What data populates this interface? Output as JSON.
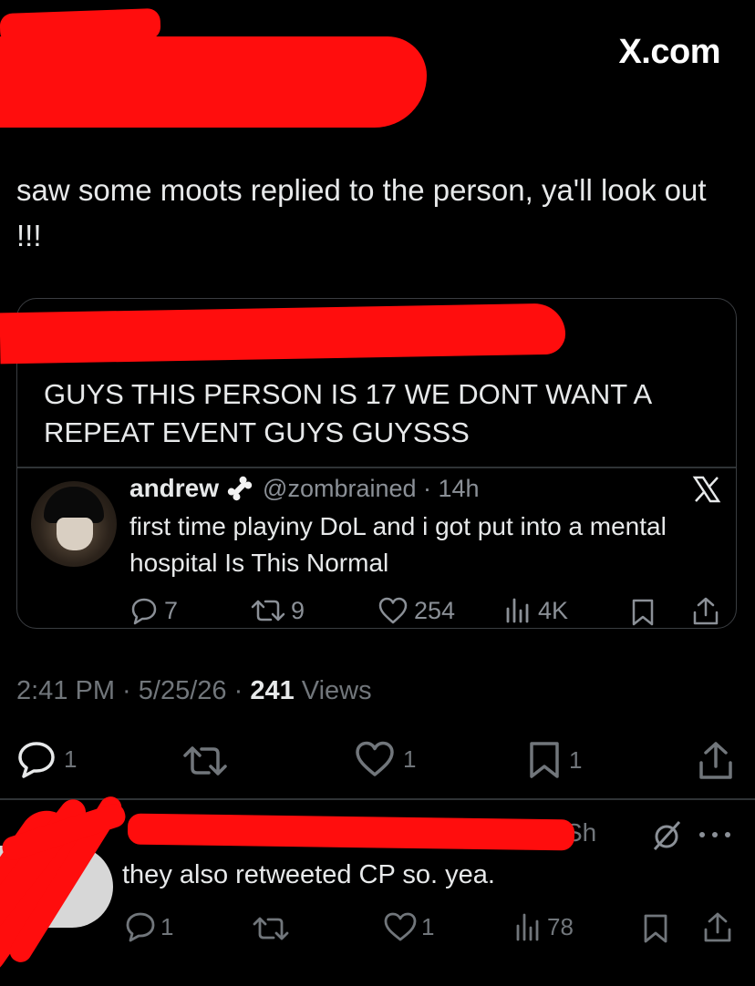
{
  "watermark": "X.com",
  "post": {
    "text": "saw some moots replied to the person, ya'll look out !!!",
    "timestamp": "2:41 PM · 5/25/26 ·",
    "views_count": "241",
    "views_label": "Views",
    "actions": {
      "reply_count": "1",
      "like_count": "1",
      "bookmark_count": "1"
    }
  },
  "quote": {
    "text": "GUYS THIS PERSON IS 17 WE DONT WANT A REPEAT EVENT GUYS GUYSSS",
    "nested": {
      "display_name": "andrew",
      "handle_time": "@zombrained · 14h",
      "text": "first time playiny DoL and i got put into a mental hospital Is This Normal",
      "reply_count": "7",
      "retweet_count": "9",
      "like_count": "254",
      "view_count": "4K"
    }
  },
  "reply": {
    "partial_name_tail": "Sh",
    "text": "they also retweeted CP so. yea.",
    "reply_count": "1",
    "like_count": "1",
    "view_count": "78"
  },
  "colors": {
    "background": "#000000",
    "text": "#e7e9ea",
    "secondary": "#71767b",
    "redaction": "#ff0d0d",
    "border": "#2f3336"
  }
}
